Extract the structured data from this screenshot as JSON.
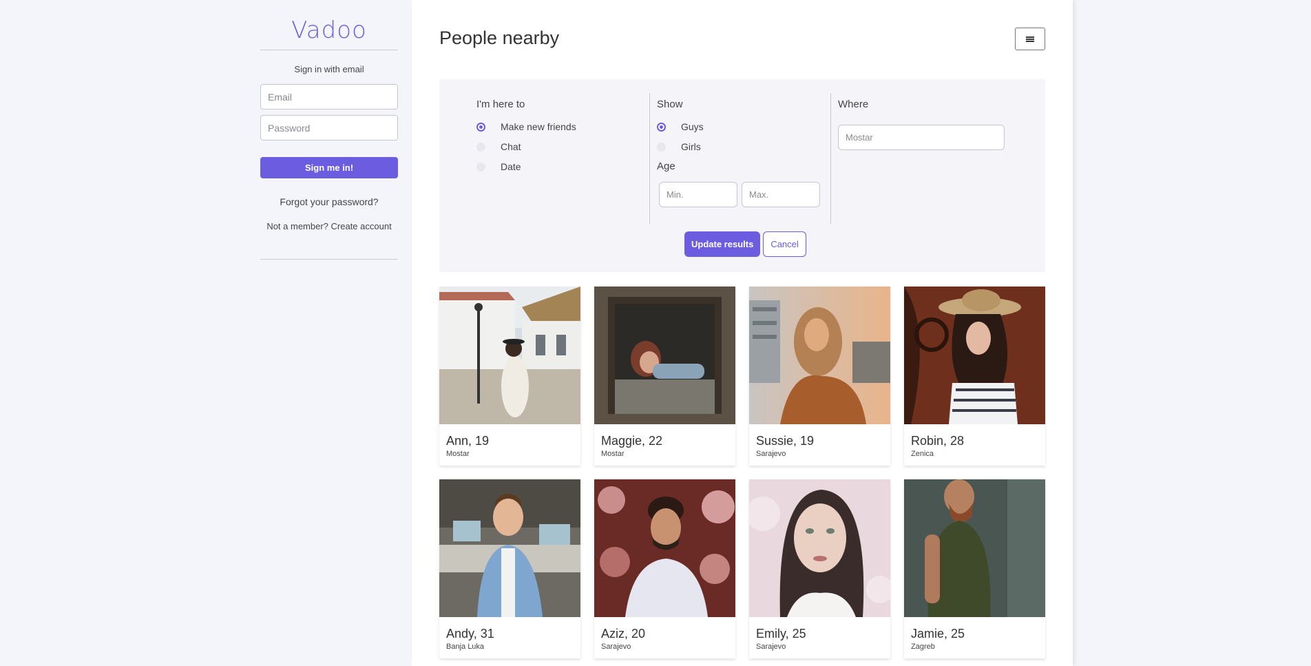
{
  "app": {
    "logo": "Vadoo"
  },
  "sidebar": {
    "signin_heading": "Sign in with email",
    "email_placeholder": "Email",
    "password_placeholder": "Password",
    "signin_button": "Sign me in!",
    "forgot_link": "Forgot your password?",
    "not_member": "Not a member? Create account"
  },
  "main": {
    "title": "People nearby",
    "menu_icon": "hamburger-icon"
  },
  "filter": {
    "here_to": {
      "label": "I'm here to",
      "options": [
        "Make new friends",
        "Chat",
        "Date"
      ],
      "selected": "Make new friends"
    },
    "show": {
      "label": "Show",
      "options": [
        "Guys",
        "Girls"
      ],
      "selected": "Guys"
    },
    "age": {
      "label": "Age",
      "min_placeholder": "Min.",
      "max_placeholder": "Max."
    },
    "where": {
      "label": "Where",
      "placeholder": "Mostar"
    },
    "update_button": "Update results",
    "cancel_button": "Cancel"
  },
  "people": [
    {
      "name": "Ann, 19",
      "city": "Mostar"
    },
    {
      "name": "Maggie, 22",
      "city": "Mostar"
    },
    {
      "name": "Sussie, 19",
      "city": "Sarajevo"
    },
    {
      "name": "Robin, 28",
      "city": "Zenica"
    },
    {
      "name": "Andy, 31",
      "city": "Banja Luka"
    },
    {
      "name": "Aziz, 20",
      "city": "Sarajevo"
    },
    {
      "name": "Emily, 25",
      "city": "Sarajevo"
    },
    {
      "name": "Jamie, 25",
      "city": "Zagreb"
    }
  ],
  "colors": {
    "accent": "#6b5ce0",
    "background": "#f4f5fa",
    "panel": "#f4f4f9"
  }
}
